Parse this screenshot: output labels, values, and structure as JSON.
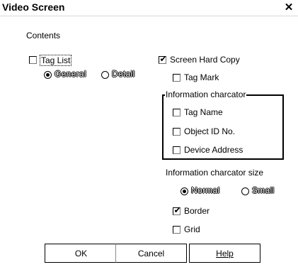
{
  "window": {
    "title": "Video Screen",
    "close_symbol": "✕"
  },
  "contents_label": "Contents",
  "tag_list": {
    "label": "Tag List",
    "checked": false,
    "options": [
      {
        "label": "General",
        "selected": true
      },
      {
        "label": "Detail",
        "selected": false
      }
    ]
  },
  "screen_hard_copy": {
    "label": "Screen Hard Copy",
    "checked": true
  },
  "tag_mark": {
    "label": "Tag Mark",
    "checked": false
  },
  "information_charcator": {
    "group_label": "Information charcator",
    "items": [
      {
        "label": "Tag Name",
        "checked": false
      },
      {
        "label": "Object ID No.",
        "checked": false
      },
      {
        "label": "Device Address",
        "checked": false
      }
    ]
  },
  "information_charcator_size": {
    "label": "Information charcator size",
    "options": [
      {
        "label": "Normal",
        "selected": true
      },
      {
        "label": "Small",
        "selected": false
      }
    ]
  },
  "border": {
    "label": "Border",
    "checked": true
  },
  "grid": {
    "label": "Grid",
    "checked": false
  },
  "buttons": {
    "ok": "OK",
    "cancel": "Cancel",
    "help": "Help"
  },
  "check_symbol": "✔"
}
